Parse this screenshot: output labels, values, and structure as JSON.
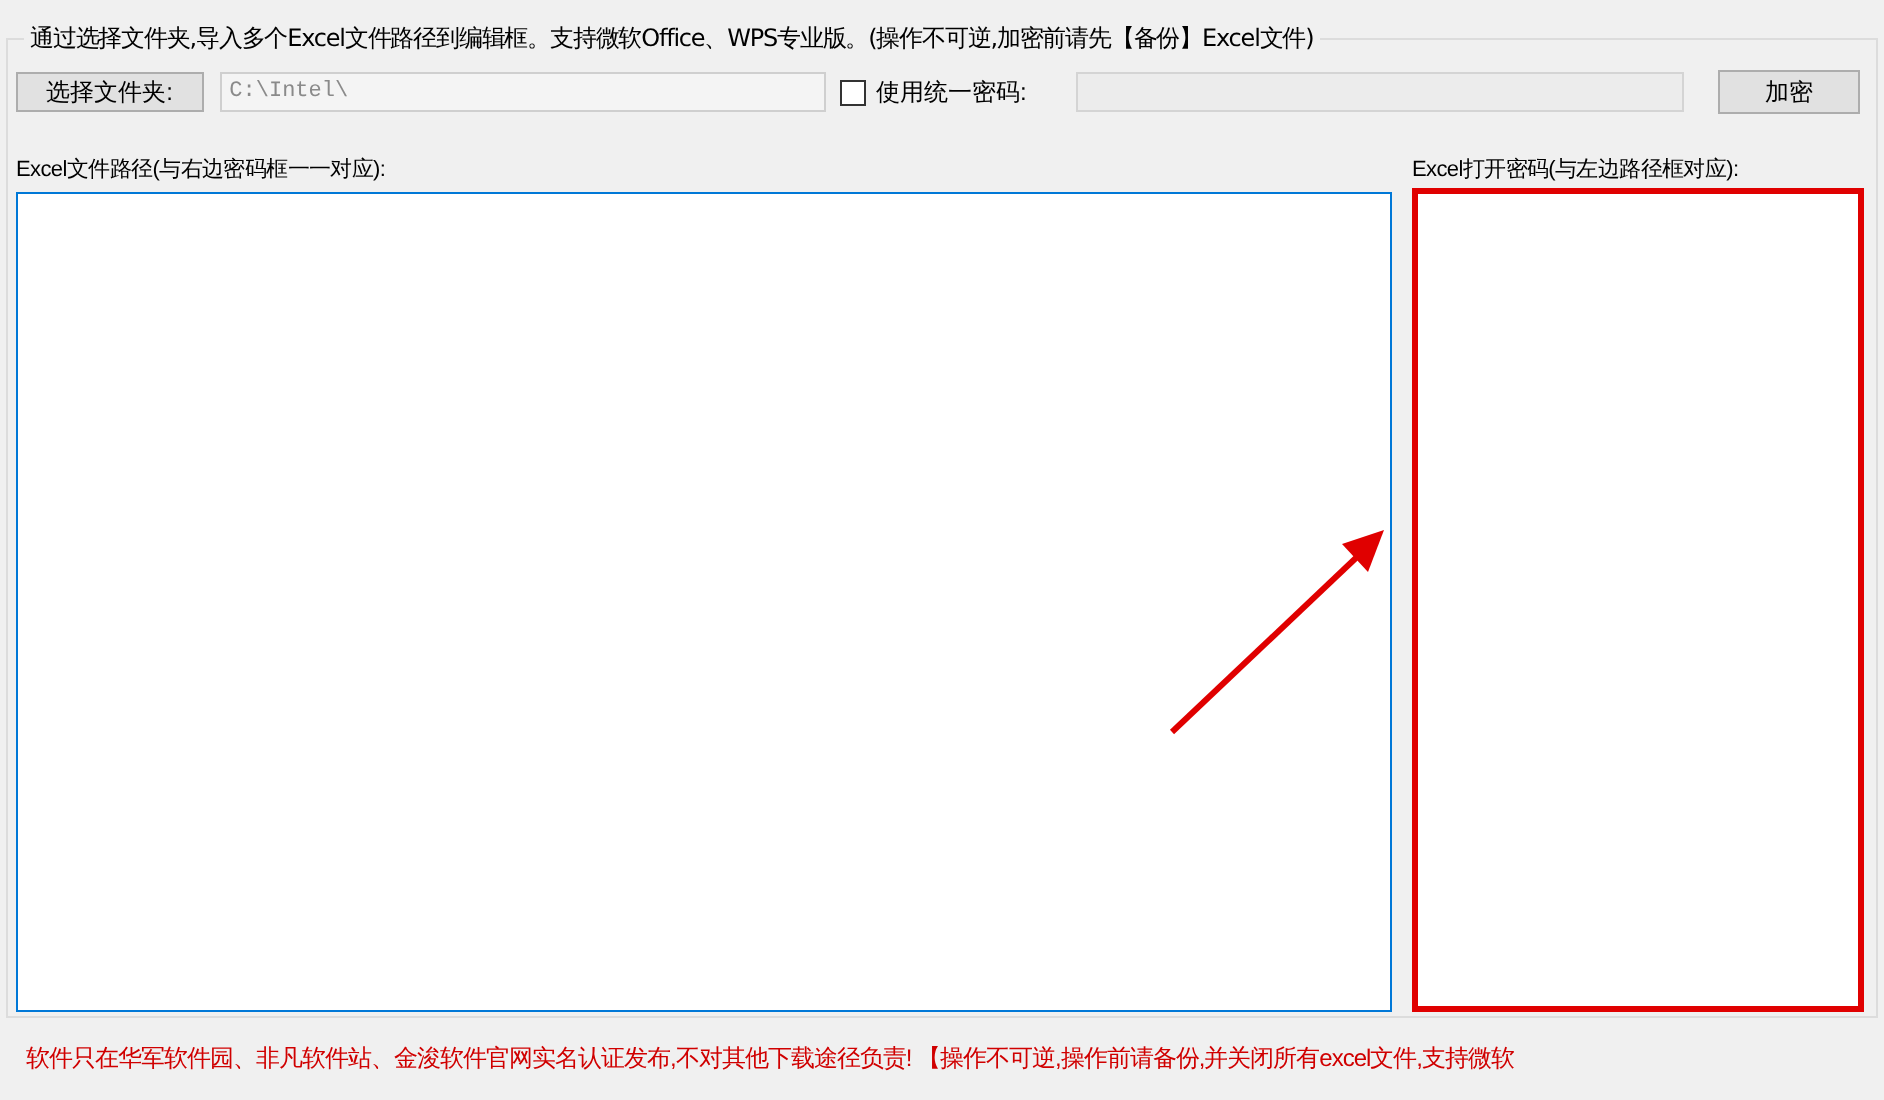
{
  "group": {
    "title": "通过选择文件夹,导入多个Excel文件路径到编辑框。支持微软Office、WPS专业版。(操作不可逆,加密前请先【备份】Excel文件)"
  },
  "folder_button": "选择文件夹:",
  "folder_path": {
    "value": "C:\\Intel\\",
    "disabled": true
  },
  "unified_password": {
    "label": "使用统一密码:",
    "checked": false
  },
  "password_field": {
    "disabled": true
  },
  "encrypt_button": "加密",
  "paths_label": "Excel文件路径(与右边密码框一一对应):",
  "passwords_label": "Excel打开密码(与左边路径框对应):",
  "passwords_highlighted": true,
  "footer": "软件只在华军软件园、非凡软件站、金浚软件官网实名认证发布,不对其他下载途径负责! 【操作不可逆,操作前请备份,并关闭所有excel文件,支持微软"
}
